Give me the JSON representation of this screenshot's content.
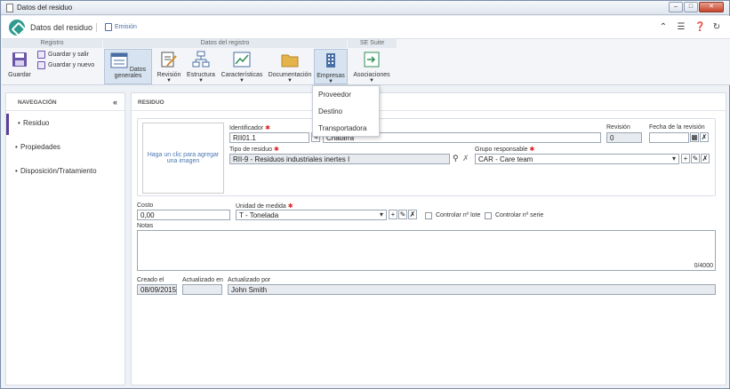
{
  "window": {
    "title": "Datos del residuo"
  },
  "header": {
    "app_title": "Datos del residuo",
    "action": "Emisión"
  },
  "ribbon": {
    "groups": [
      "Registro",
      "Datos del registro",
      "SE Suite"
    ],
    "save": "Guardar",
    "save_exit": "Guardar y salir",
    "save_new": "Guardar y nuevo",
    "general": "Datos generales",
    "revision": "Revisión",
    "structure": "Estructura",
    "characteristics": "Características",
    "documentation": "Documentación",
    "companies": "Empresas",
    "associations": "Asociaciones"
  },
  "companies_menu": [
    "Proveedor",
    "Destino",
    "Transportadora"
  ],
  "nav": {
    "title": "NAVEGACIÓN",
    "items": [
      "Residuo",
      "Propiedades",
      "Disposición/Tratamiento"
    ]
  },
  "main": {
    "title": "RESIDUO",
    "image_hint": "Haga un clic para agregar una imagen",
    "identifier_label": "Identificador",
    "identifier_value": "RII01.1",
    "name_value": "Chatarra",
    "revision_label": "Revisión",
    "revision_value": "0",
    "revision_date_label": "Fecha de la revisión",
    "type_label": "Tipo de residuo",
    "type_value": "RII-9 - Residuos industriales inertes I",
    "group_label": "Grupo responsable",
    "group_value": "CAR - Care team",
    "cost_label": "Costo",
    "cost_value": "0,00",
    "unit_label": "Unidad de medida",
    "unit_value": "T - Tonelada",
    "lot_label": "Controlar nº lote",
    "serial_label": "Controlar nº serie",
    "notes_label": "Notas",
    "notes_counter": "0/4000",
    "created_label": "Creado el",
    "created_value": "08/09/2015",
    "updated_label": "Actualizado en",
    "updated_value": "",
    "updated_by_label": "Actualizado por",
    "updated_by_value": "John Smith"
  },
  "colors": {
    "accent": "#5a3f97",
    "logo": "#2f9a8e",
    "link": "#4a78b5"
  }
}
